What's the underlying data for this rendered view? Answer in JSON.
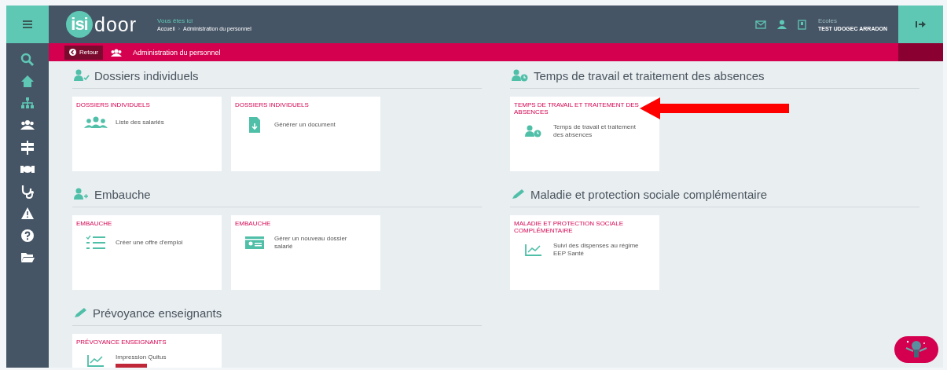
{
  "header": {
    "logo": {
      "badge": "isi",
      "word": "door"
    },
    "breadcrumb": {
      "label": "Vous êtes ici",
      "items": [
        "Accueil",
        "Administration du personnel"
      ],
      "separator": "›"
    },
    "user": {
      "label": "Ecoles",
      "name": "TEST UDOGEC ARRADON"
    }
  },
  "subbar": {
    "back": "Retour",
    "title": "Administration du personnel"
  },
  "sidebar": {
    "items": [
      {
        "kind": "search"
      },
      {
        "kind": "home"
      },
      {
        "kind": "org"
      },
      {
        "kind": "people"
      },
      {
        "kind": "signpost"
      },
      {
        "kind": "handshake"
      },
      {
        "kind": "stethoscope"
      },
      {
        "kind": "warning"
      },
      {
        "kind": "help"
      },
      {
        "kind": "folder"
      }
    ]
  },
  "columns": [
    {
      "sections": [
        {
          "title": "Dossiers individuels",
          "cards": [
            {
              "category": "DOSSIERS INDIVIDUELS",
              "label": "Liste des salariés"
            },
            {
              "category": "DOSSIERS INDIVIDUELS",
              "label": "Générer un document"
            }
          ]
        },
        {
          "title": "Embauche",
          "cards": [
            {
              "category": "EMBAUCHE",
              "label": "Créer une offre d'emploi"
            },
            {
              "category": "EMBAUCHE",
              "label": "Gérer un nouveau dossier salarié"
            }
          ]
        },
        {
          "title": "Prévoyance enseignants",
          "cards": [
            {
              "category": "PRÉVOYANCE ENSEIGNANTS",
              "label": "Impression Quitus",
              "flagged": true
            }
          ]
        }
      ]
    },
    {
      "sections": [
        {
          "title": "Temps de travail et traitement des absences",
          "cards": [
            {
              "category": "TEMPS DE TRAVAIL ET TRAITEMENT DES ABSENCES",
              "label": "Temps de travail et traitement des absences"
            }
          ]
        },
        {
          "title": "Maladie et protection sociale complémentaire",
          "cards": [
            {
              "category": "MALADIE ET PROTECTION SOCIALE COMPLÉMENTAIRE",
              "label": "Suivi des dispenses au régime EEP Santé"
            }
          ]
        }
      ]
    }
  ]
}
